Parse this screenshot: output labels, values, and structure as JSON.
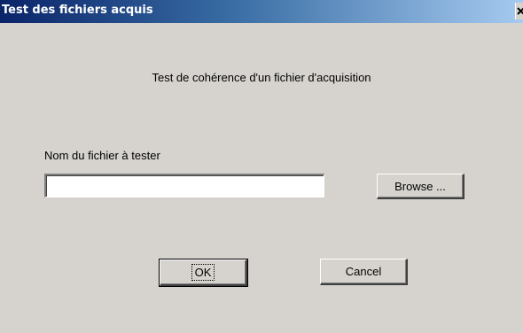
{
  "window": {
    "title": "Test des fichiers acquis",
    "close_symbol": "×"
  },
  "dialog": {
    "heading": "Test de cohérence d'un fichier d'acquisition",
    "file_label": "Nom du fichier à tester",
    "file_value": "",
    "browse_label": "Browse ...",
    "ok_label": "OK",
    "cancel_label": "Cancel"
  },
  "icons": {
    "close": "close-icon"
  },
  "colors": {
    "titlebar_start": "#0a246a",
    "titlebar_end": "#a6caf0",
    "dialog_background": "#d6d3ce"
  }
}
